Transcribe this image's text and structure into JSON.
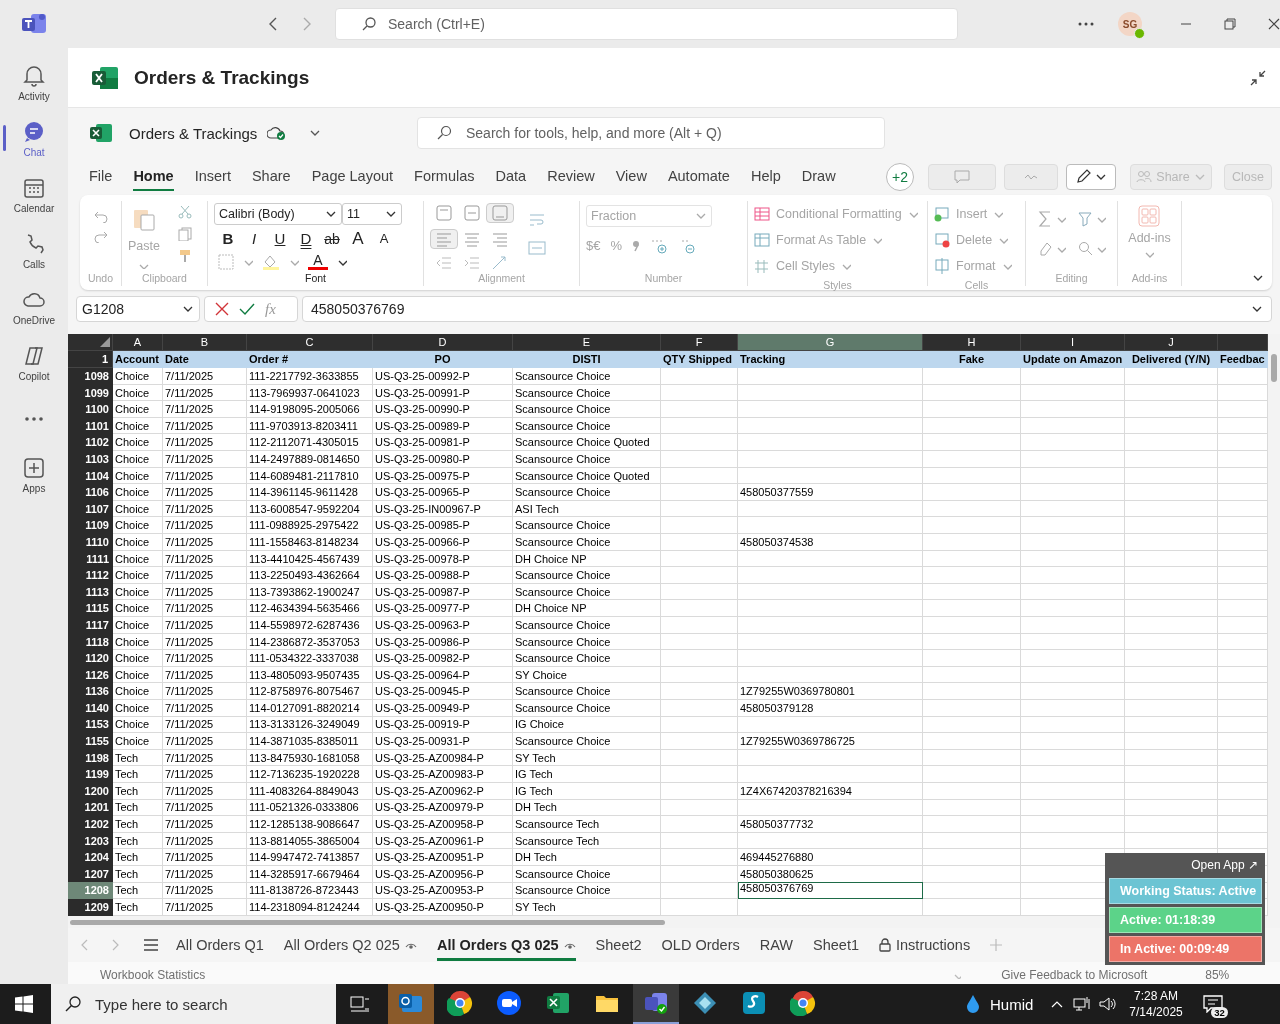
{
  "teams": {
    "search_placeholder": "Search (Ctrl+E)",
    "avatar_initials": "SG"
  },
  "rail": [
    {
      "label": "Activity",
      "kind": "bell",
      "selected": false
    },
    {
      "label": "Chat",
      "kind": "chat",
      "selected": true
    },
    {
      "label": "Calendar",
      "kind": "calendar",
      "selected": false
    },
    {
      "label": "Calls",
      "kind": "phone",
      "selected": false
    },
    {
      "label": "OneDrive",
      "kind": "cloud",
      "selected": false
    },
    {
      "label": "Copilot",
      "kind": "copilot",
      "selected": false
    },
    {
      "kind": "more",
      "selected": false
    },
    {
      "label": "Apps",
      "kind": "apps",
      "selected": false
    }
  ],
  "app_title": "Orders & Trackings",
  "workbook": {
    "name": "Orders & Trackings",
    "search_placeholder": "Search for tools, help, and more (Alt + Q)"
  },
  "menu": [
    {
      "label": "File",
      "selected": false
    },
    {
      "label": "Home",
      "selected": true
    },
    {
      "label": "Insert",
      "selected": false
    },
    {
      "label": "Share",
      "selected": false
    },
    {
      "label": "Page Layout",
      "selected": false
    },
    {
      "label": "Formulas",
      "selected": false
    },
    {
      "label": "Data",
      "selected": false
    },
    {
      "label": "Review",
      "selected": false
    },
    {
      "label": "View",
      "selected": false
    },
    {
      "label": "Automate",
      "selected": false
    },
    {
      "label": "Help",
      "selected": false
    },
    {
      "label": "Draw",
      "selected": false
    }
  ],
  "toolbar": {
    "collaborators": "+2",
    "share": "Share",
    "close": "Close"
  },
  "ribbon": {
    "groups": [
      "Undo",
      "Clipboard",
      "Font",
      "Alignment",
      "Number",
      "Styles",
      "Cells",
      "Editing",
      "Add-ins"
    ],
    "paste": "Paste",
    "font_name": "Calibri (Body)",
    "font_size": "11",
    "font_buttons": [
      {
        "label": "B",
        "kind": "bold"
      },
      {
        "label": "I",
        "kind": "italic"
      },
      {
        "label": "U",
        "kind": "underline"
      },
      {
        "label": "D",
        "kind": "double"
      },
      {
        "label": "ab",
        "kind": "strike"
      },
      {
        "label": "A",
        "kind": "grow"
      },
      {
        "label": "A",
        "kind": "shrink"
      }
    ],
    "font_color": "A",
    "number_format": "Fraction",
    "number_buttons": [
      "$€",
      "%"
    ],
    "styles": [
      "Conditional Formatting",
      "Format As Table",
      "Cell Styles"
    ],
    "cells": [
      "Insert",
      "Delete",
      "Format"
    ],
    "addins": "Add-ins"
  },
  "formula_bar": {
    "name_box": "G1208",
    "fx": "fx",
    "value": "458050376769"
  },
  "sheet": {
    "columns": [
      {
        "letter": "A",
        "header": "Account",
        "selected": false
      },
      {
        "letter": "B",
        "header": "Date",
        "selected": false
      },
      {
        "letter": "C",
        "header": "Order #",
        "selected": false
      },
      {
        "letter": "D",
        "header": "PO",
        "selected": false
      },
      {
        "letter": "E",
        "header": "DISTI",
        "selected": false
      },
      {
        "letter": "F",
        "header": "QTY Shipped",
        "selected": false
      },
      {
        "letter": "G",
        "header": "Tracking",
        "selected": true
      },
      {
        "letter": "H",
        "header": "Fake",
        "selected": false
      },
      {
        "letter": "I",
        "header": "Update on Amazon",
        "selected": false
      },
      {
        "letter": "J",
        "header": "Delivered (Y/N)",
        "selected": false
      },
      {
        "header": "Feedbac",
        "selected": false
      }
    ],
    "header_row_number": "1",
    "rows": [
      {
        "number": "1098",
        "account": "Choice",
        "date": "7/11/2025",
        "order": "111-2217792-3633855",
        "po": "US-Q3-25-00992-P",
        "disti": "Scansource Choice",
        "selected": false
      },
      {
        "number": "1099",
        "account": "Choice",
        "date": "7/11/2025",
        "order": "113-7969937-0641023",
        "po": "US-Q3-25-00991-P",
        "disti": "Scansource Choice",
        "selected": false
      },
      {
        "number": "1100",
        "account": "Choice",
        "date": "7/11/2025",
        "order": "114-9198095-2005066",
        "po": "US-Q3-25-00990-P",
        "disti": "Scansource Choice",
        "selected": false
      },
      {
        "number": "1101",
        "account": "Choice",
        "date": "7/11/2025",
        "order": "111-9703913-8203411",
        "po": "US-Q3-25-00989-P",
        "disti": "Scansource Choice",
        "selected": false
      },
      {
        "number": "1102",
        "account": "Choice",
        "date": "7/11/2025",
        "order": "112-2112071-4305015",
        "po": "US-Q3-25-00981-P",
        "disti": "Scansource Choice Quoted",
        "selected": false
      },
      {
        "number": "1103",
        "account": "Choice",
        "date": "7/11/2025",
        "order": "114-2497889-0814650",
        "po": "US-Q3-25-00980-P",
        "disti": "Scansource Choice",
        "selected": false
      },
      {
        "number": "1104",
        "account": "Choice",
        "date": "7/11/2025",
        "order": "114-6089481-2117810",
        "po": "US-Q3-25-00975-P",
        "disti": "Scansource Choice Quoted",
        "selected": false
      },
      {
        "number": "1106",
        "account": "Choice",
        "date": "7/11/2025",
        "order": "114-3961145-9611428",
        "po": "US-Q3-25-00965-P",
        "disti": "Scansource Choice",
        "tracking": "458050377559",
        "selected": false
      },
      {
        "number": "1107",
        "account": "Choice",
        "date": "7/11/2025",
        "order": "113-6008547-9592204",
        "po": "US-Q3-25-IN00967-P",
        "disti": "ASI Tech",
        "selected": false
      },
      {
        "number": "1109",
        "account": "Choice",
        "date": "7/11/2025",
        "order": "111-0988925-2975422",
        "po": "US-Q3-25-00985-P",
        "disti": "Scansource Choice",
        "selected": false
      },
      {
        "number": "1110",
        "account": "Choice",
        "date": "7/11/2025",
        "order": "111-1558463-8148234",
        "po": "US-Q3-25-00966-P",
        "disti": "Scansource Choice",
        "tracking": "458050374538",
        "selected": false
      },
      {
        "number": "1111",
        "account": "Choice",
        "date": "7/11/2025",
        "order": "113-4410425-4567439",
        "po": "US-Q3-25-00978-P",
        "disti": "DH Choice NP",
        "selected": false
      },
      {
        "number": "1112",
        "account": "Choice",
        "date": "7/11/2025",
        "order": "113-2250493-4362664",
        "po": "US-Q3-25-00988-P",
        "disti": "Scansource Choice",
        "selected": false
      },
      {
        "number": "1113",
        "account": "Choice",
        "date": "7/11/2025",
        "order": "113-7393862-1900247",
        "po": "US-Q3-25-00987-P",
        "disti": "Scansource Choice",
        "selected": false
      },
      {
        "number": "1115",
        "account": "Choice",
        "date": "7/11/2025",
        "order": "112-4634394-5635466",
        "po": "US-Q3-25-00977-P",
        "disti": "DH Choice NP",
        "selected": false
      },
      {
        "number": "1117",
        "account": "Choice",
        "date": "7/11/2025",
        "order": "114-5598972-6287436",
        "po": "US-Q3-25-00963-P",
        "disti": "Scansource Choice",
        "selected": false
      },
      {
        "number": "1118",
        "account": "Choice",
        "date": "7/11/2025",
        "order": "114-2386872-3537053",
        "po": "US-Q3-25-00986-P",
        "disti": "Scansource Choice",
        "selected": false
      },
      {
        "number": "1120",
        "account": "Choice",
        "date": "7/11/2025",
        "order": "111-0534322-3337038",
        "po": "US-Q3-25-00982-P",
        "disti": "Scansource Choice",
        "selected": false
      },
      {
        "number": "1126",
        "account": "Choice",
        "date": "7/11/2025",
        "order": "113-4805093-9507435",
        "po": "US-Q3-25-00964-P",
        "disti": "SY Choice",
        "selected": false
      },
      {
        "number": "1136",
        "account": "Choice",
        "date": "7/11/2025",
        "order": "112-8758976-8075467",
        "po": "US-Q3-25-00945-P",
        "disti": "Scansource Choice",
        "tracking": "1Z79255W0369780801",
        "selected": false
      },
      {
        "number": "1140",
        "account": "Choice",
        "date": "7/11/2025",
        "order": "114-0127091-8820214",
        "po": "US-Q3-25-00949-P",
        "disti": "Scansource Choice",
        "tracking": "458050379128",
        "selected": false
      },
      {
        "number": "1153",
        "account": "Choice",
        "date": "7/11/2025",
        "order": "113-3133126-3249049",
        "po": "US-Q3-25-00919-P",
        "disti": "IG Choice",
        "selected": false
      },
      {
        "number": "1155",
        "account": "Choice",
        "date": "7/11/2025",
        "order": "114-3871035-8385011",
        "po": "US-Q3-25-00931-P",
        "disti": "Scansource Choice",
        "tracking": "1Z79255W0369786725",
        "selected": false
      },
      {
        "number": "1198",
        "account": "Tech",
        "date": "7/11/2025",
        "order": "113-8475930-1681058",
        "po": "US-Q3-25-AZ00984-P",
        "disti": "SY Tech",
        "selected": false
      },
      {
        "number": "1199",
        "account": "Tech",
        "date": "7/11/2025",
        "order": "112-7136235-1920228",
        "po": "US-Q3-25-AZ00983-P",
        "disti": "IG Tech",
        "selected": false
      },
      {
        "number": "1200",
        "account": "Tech",
        "date": "7/11/2025",
        "order": "111-4083264-8849043",
        "po": "US-Q3-25-AZ00962-P",
        "disti": "IG Tech",
        "tracking": "1Z4X67420378216394",
        "selected": false
      },
      {
        "number": "1201",
        "account": "Tech",
        "date": "7/11/2025",
        "order": "111-0521326-0333806",
        "po": "US-Q3-25-AZ00979-P",
        "disti": "DH Tech",
        "selected": false
      },
      {
        "number": "1202",
        "account": "Tech",
        "date": "7/11/2025",
        "order": "112-1285138-9086647",
        "po": "US-Q3-25-AZ00958-P",
        "disti": "Scansource Tech",
        "tracking": "458050377732",
        "selected": false
      },
      {
        "number": "1203",
        "account": "Tech",
        "date": "7/11/2025",
        "order": "113-8814055-3865004",
        "po": "US-Q3-25-AZ00961-P",
        "disti": "Scansource Tech",
        "selected": false
      },
      {
        "number": "1204",
        "account": "Tech",
        "date": "7/11/2025",
        "order": "114-9947472-7413857",
        "po": "US-Q3-25-AZ00951-P",
        "disti": "DH Tech",
        "tracking": "469445276880",
        "selected": false
      },
      {
        "number": "1207",
        "account": "Tech",
        "date": "7/11/2025",
        "order": "114-3285917-6679464",
        "po": "US-Q3-25-AZ00956-P",
        "disti": "Scansource Choice",
        "tracking": "458050380625",
        "selected": false
      },
      {
        "number": "1208",
        "account": "Tech",
        "date": "7/11/2025",
        "order": "111-8138726-8723443",
        "po": "US-Q3-25-AZ00953-P",
        "disti": "Scansource Choice",
        "tracking": "458050376769",
        "selected": true
      },
      {
        "number": "1209",
        "account": "Tech",
        "date": "7/11/2025",
        "order": "114-2318094-8124244",
        "po": "US-Q3-25-AZ00950-P",
        "disti": "SY Tech",
        "selected": false
      }
    ]
  },
  "sheet_tabs": [
    {
      "label": "All Orders Q1",
      "kind": "plain",
      "selected": false
    },
    {
      "label": "All Orders Q2 025",
      "kind": "viewed",
      "selected": false
    },
    {
      "label": "All Orders Q3 025",
      "kind": "viewed",
      "selected": true
    },
    {
      "label": "Sheet2",
      "kind": "plain",
      "selected": false
    },
    {
      "label": "OLD Orders",
      "kind": "plain",
      "selected": false
    },
    {
      "label": "RAW",
      "kind": "plain",
      "selected": false
    },
    {
      "label": "Sheet1",
      "kind": "plain",
      "selected": false
    },
    {
      "label": "Instructions",
      "kind": "locked",
      "selected": false
    }
  ],
  "status_bar": {
    "left": "Workbook Statistics",
    "feedback": "Give Feedback to Microsoft",
    "zoom": "85%"
  },
  "widget": {
    "open_app": "Open App ↗",
    "items": [
      {
        "label": "Working Status: Active",
        "color": "#6cc4d3"
      },
      {
        "label": "Active: 01:18:39",
        "color": "#5cd389"
      },
      {
        "label": "In Active: 00:09:49",
        "color": "#ec7468"
      }
    ]
  },
  "taskbar": {
    "search_placeholder": "Type here to search",
    "apps": [
      {
        "kind": "mail",
        "selected": false,
        "flashing": true
      },
      {
        "kind": "browser",
        "selected": false,
        "flashing": false
      },
      {
        "kind": "video",
        "selected": false,
        "flashing": false
      },
      {
        "kind": "sheet",
        "selected": false,
        "flashing": false
      },
      {
        "kind": "folder",
        "selected": false,
        "flashing": false
      },
      {
        "kind": "chat",
        "selected": true,
        "flashing": false
      },
      {
        "kind": "diamond",
        "selected": false,
        "flashing": false
      },
      {
        "kind": "stroke",
        "selected": false,
        "flashing": false
      },
      {
        "kind": "browser",
        "selected": false,
        "flashing": false
      }
    ],
    "weather": "Humid",
    "time": "7:28 AM",
    "date": "7/14/2025",
    "notifications": "32"
  }
}
